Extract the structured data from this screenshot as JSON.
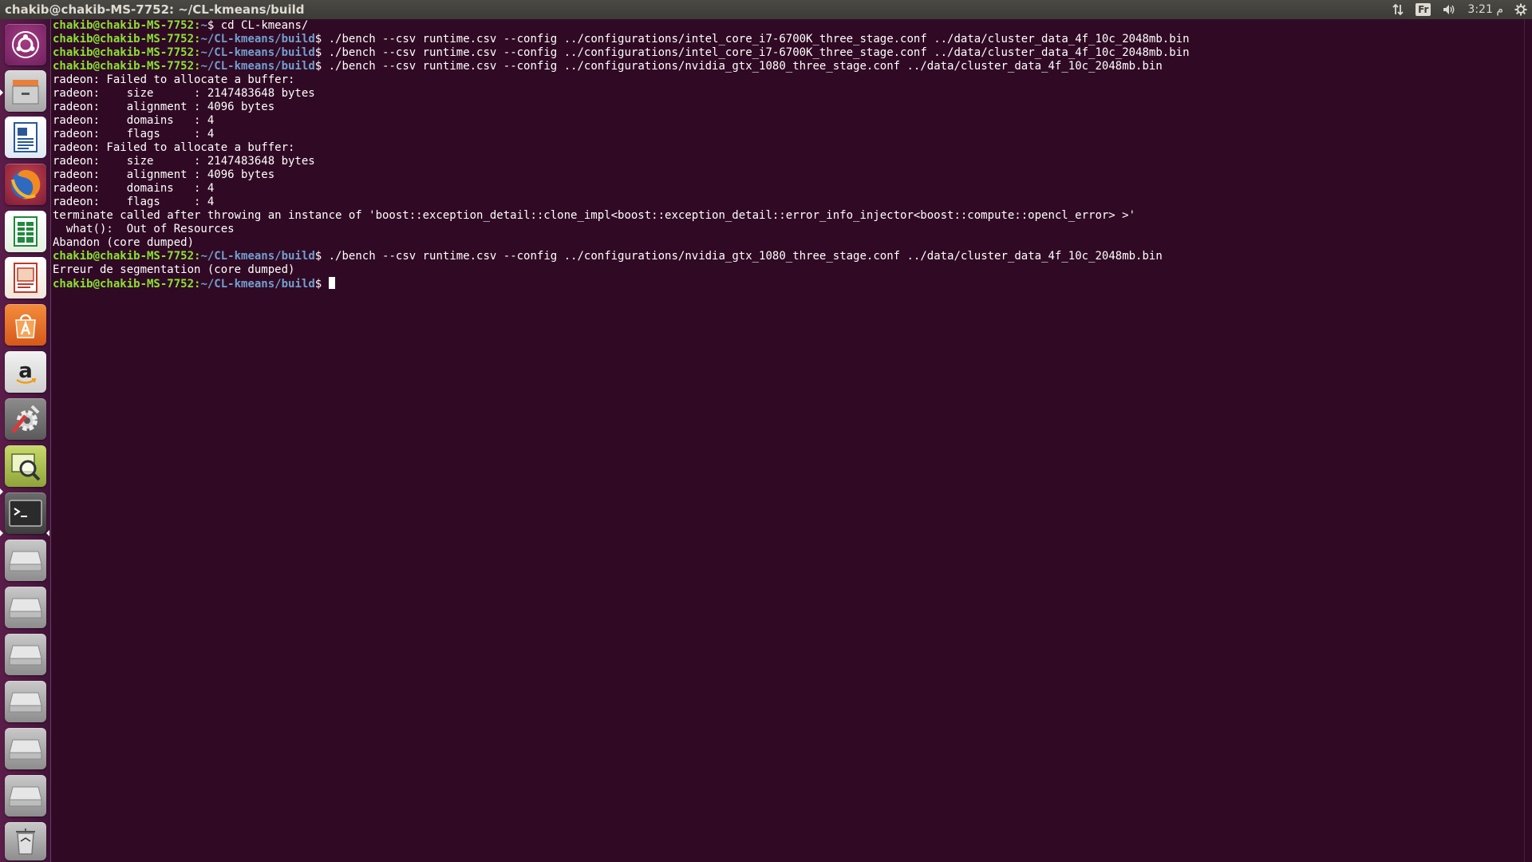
{
  "topbar": {
    "title": "chakib@chakib-MS-7752: ~/CL-kmeans/build",
    "keyboard_layout": "Fr",
    "clock": "م 3:21"
  },
  "launcher": {
    "items": [
      {
        "name": "Dash",
        "icon": "ubuntu-logo-icon"
      },
      {
        "name": "Files",
        "icon": "file-cabinet-icon"
      },
      {
        "name": "LibreOffice Writer",
        "icon": "writer-icon"
      },
      {
        "name": "Firefox",
        "icon": "firefox-icon"
      },
      {
        "name": "LibreOffice Calc",
        "icon": "calc-icon"
      },
      {
        "name": "LibreOffice Impress",
        "icon": "impress-icon"
      },
      {
        "name": "Ubuntu Software",
        "icon": "software-center-icon"
      },
      {
        "name": "Amazon",
        "icon": "amazon-icon"
      },
      {
        "name": "System Settings",
        "icon": "settings-icon"
      },
      {
        "name": "Image Viewer",
        "icon": "image-viewer-icon"
      },
      {
        "name": "Terminal",
        "icon": "terminal-icon"
      },
      {
        "name": "Drive 1",
        "icon": "drive-icon"
      },
      {
        "name": "Drive 2",
        "icon": "drive-icon"
      },
      {
        "name": "Drive 3",
        "icon": "drive-icon"
      },
      {
        "name": "Drive 4",
        "icon": "drive-icon"
      },
      {
        "name": "Drive 5",
        "icon": "drive-icon"
      },
      {
        "name": "Drive 6",
        "icon": "drive-icon"
      },
      {
        "name": "Trash",
        "icon": "trash-icon"
      }
    ]
  },
  "terminal": {
    "prompt_user": "chakib@chakib-MS-7752",
    "prompt_sep": ":",
    "lines": [
      {
        "type": "prompt",
        "path": "~",
        "cmd": " cd CL-kmeans/"
      },
      {
        "type": "prompt",
        "path": "~/CL-kmeans/build",
        "cmd": " ./bench --csv runtime.csv --config ../configurations/intel_core_i7-6700K_three_stage.conf ../data/cluster_data_4f_10c_2048mb.bin"
      },
      {
        "type": "prompt",
        "path": "~/CL-kmeans/build",
        "cmd": " ./bench --csv runtime.csv --config ../configurations/intel_core_i7-6700K_three_stage.conf ../data/cluster_data_4f_10c_2048mb.bin"
      },
      {
        "type": "prompt",
        "path": "~/CL-kmeans/build",
        "cmd": " ./bench --csv runtime.csv --config ../configurations/nvidia_gtx_1080_three_stage.conf ../data/cluster_data_4f_10c_2048mb.bin"
      },
      {
        "type": "output",
        "text": "radeon: Failed to allocate a buffer:"
      },
      {
        "type": "output",
        "text": "radeon:    size      : 2147483648 bytes"
      },
      {
        "type": "output",
        "text": "radeon:    alignment : 4096 bytes"
      },
      {
        "type": "output",
        "text": "radeon:    domains   : 4"
      },
      {
        "type": "output",
        "text": "radeon:    flags     : 4"
      },
      {
        "type": "output",
        "text": "radeon: Failed to allocate a buffer:"
      },
      {
        "type": "output",
        "text": "radeon:    size      : 2147483648 bytes"
      },
      {
        "type": "output",
        "text": "radeon:    alignment : 4096 bytes"
      },
      {
        "type": "output",
        "text": "radeon:    domains   : 4"
      },
      {
        "type": "output",
        "text": "radeon:    flags     : 4"
      },
      {
        "type": "output",
        "text": "terminate called after throwing an instance of 'boost::exception_detail::clone_impl<boost::exception_detail::error_info_injector<boost::compute::opencl_error> >'"
      },
      {
        "type": "output",
        "text": "  what():  Out of Resources"
      },
      {
        "type": "output",
        "text": "Abandon (core dumped)"
      },
      {
        "type": "prompt",
        "path": "~/CL-kmeans/build",
        "cmd": " ./bench --csv runtime.csv --config ../configurations/nvidia_gtx_1080_three_stage.conf ../data/cluster_data_4f_10c_2048mb.bin"
      },
      {
        "type": "output",
        "text": "Erreur de segmentation (core dumped)"
      },
      {
        "type": "prompt",
        "path": "~/CL-kmeans/build",
        "cmd": " ",
        "cursor": true
      }
    ]
  },
  "colors": {
    "terminal_bg": "#300a24",
    "prompt_user": "#8ae234",
    "prompt_path": "#729fcf",
    "text": "#ffffff"
  }
}
